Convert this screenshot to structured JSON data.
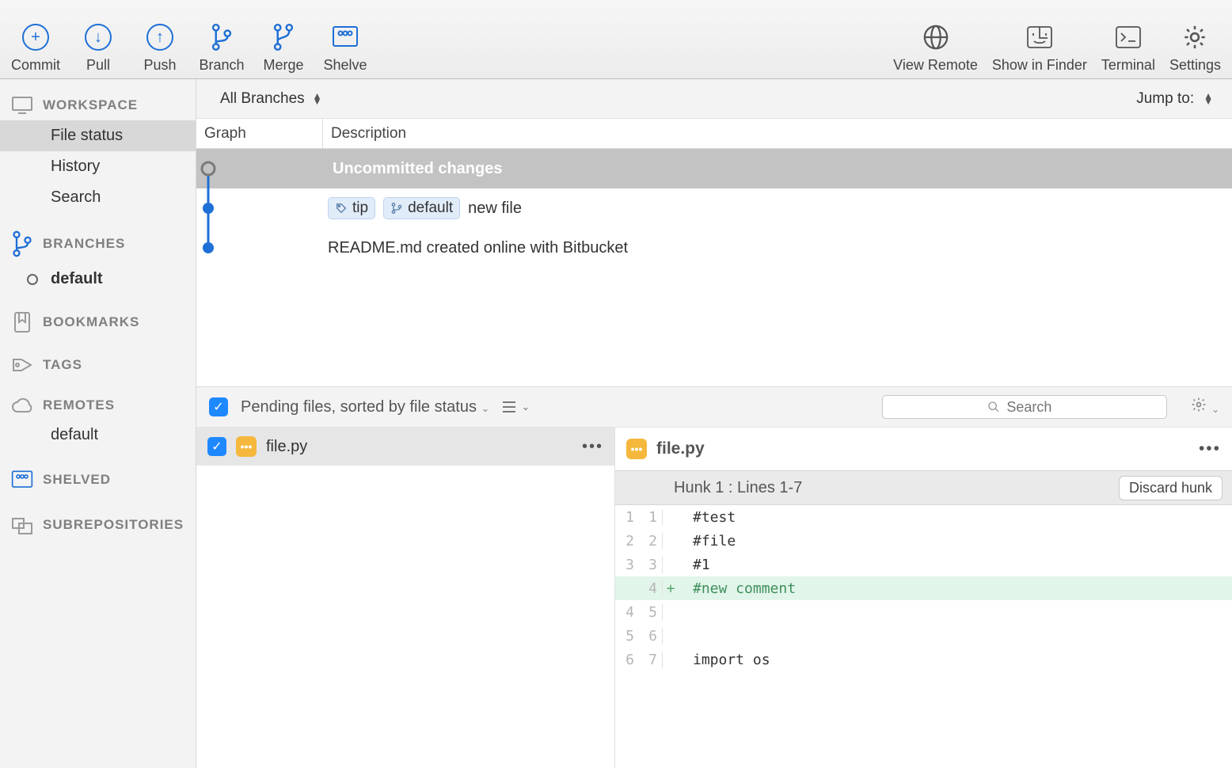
{
  "toolbar": {
    "left": [
      {
        "name": "commit",
        "label": "Commit",
        "icon": "plus"
      },
      {
        "name": "pull",
        "label": "Pull",
        "icon": "down"
      },
      {
        "name": "push",
        "label": "Push",
        "icon": "up"
      },
      {
        "name": "branch",
        "label": "Branch",
        "icon": "branch"
      },
      {
        "name": "merge",
        "label": "Merge",
        "icon": "merge"
      },
      {
        "name": "shelve",
        "label": "Shelve",
        "icon": "shelve"
      }
    ],
    "right": [
      {
        "name": "view-remote",
        "label": "View Remote",
        "icon": "globe"
      },
      {
        "name": "show-in-finder",
        "label": "Show in Finder",
        "icon": "finder"
      },
      {
        "name": "terminal",
        "label": "Terminal",
        "icon": "terminal"
      },
      {
        "name": "settings",
        "label": "Settings",
        "icon": "gear"
      }
    ]
  },
  "sidebar": {
    "sections": [
      {
        "title": "WORKSPACE",
        "icon": "monitor",
        "items": [
          {
            "label": "File status",
            "active": true
          },
          {
            "label": "History"
          },
          {
            "label": "Search"
          }
        ]
      },
      {
        "title": "BRANCHES",
        "icon": "branch",
        "items": [
          {
            "label": "default",
            "bold": true,
            "dot": true
          }
        ]
      },
      {
        "title": "BOOKMARKS",
        "icon": "bookmark",
        "items": []
      },
      {
        "title": "TAGS",
        "icon": "tag",
        "items": []
      },
      {
        "title": "REMOTES",
        "icon": "cloud",
        "items": [
          {
            "label": "default"
          }
        ]
      },
      {
        "title": "SHELVED",
        "icon": "shelve",
        "items": []
      },
      {
        "title": "SUBREPOSITORIES",
        "icon": "subrepo",
        "items": []
      }
    ]
  },
  "history": {
    "branch_filter": "All Branches",
    "jump_label": "Jump to:",
    "columns": {
      "graph": "Graph",
      "description": "Description"
    },
    "rows": [
      {
        "type": "uncommitted",
        "description": "Uncommitted changes"
      },
      {
        "type": "commit",
        "badges": [
          "tip",
          "default"
        ],
        "description": "new file"
      },
      {
        "type": "commit",
        "badges": [],
        "description": "README.md created online with Bitbucket"
      }
    ]
  },
  "filestatus": {
    "sort_label": "Pending files, sorted by file status",
    "search_placeholder": "Search",
    "files": [
      {
        "name": "file.py"
      }
    ]
  },
  "diff": {
    "file": "file.py",
    "hunk_label": "Hunk 1 : Lines 1-7",
    "discard_label": "Discard hunk",
    "lines": [
      {
        "old": "1",
        "new": "1",
        "op": " ",
        "text": "#test"
      },
      {
        "old": "2",
        "new": "2",
        "op": " ",
        "text": "#file"
      },
      {
        "old": "3",
        "new": "3",
        "op": " ",
        "text": "#1"
      },
      {
        "old": "",
        "new": "4",
        "op": "+",
        "text": "#new comment"
      },
      {
        "old": "4",
        "new": "5",
        "op": " ",
        "text": ""
      },
      {
        "old": "5",
        "new": "6",
        "op": " ",
        "text": ""
      },
      {
        "old": "6",
        "new": "7",
        "op": " ",
        "text": "import os"
      }
    ]
  }
}
